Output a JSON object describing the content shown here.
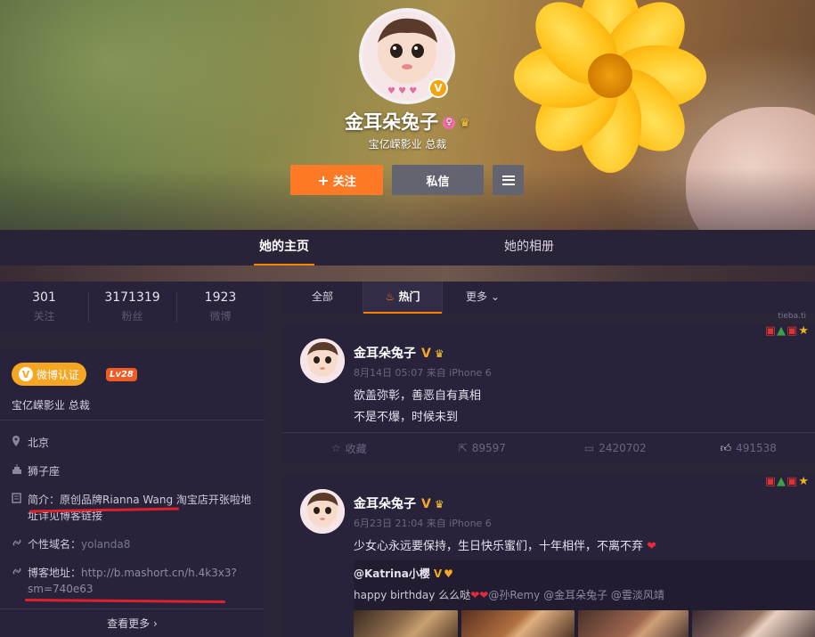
{
  "profile": {
    "name": "金耳朵兔子",
    "description": "宝亿嵘影业 总裁",
    "follow_label": "关注",
    "message_label": "私信",
    "verified_mark": "V",
    "female_icon": "♀",
    "crown_icon": "♛"
  },
  "nav": {
    "tabs": [
      {
        "label": "她的主页",
        "active": true
      },
      {
        "label": "她的相册",
        "active": false
      }
    ]
  },
  "stats": [
    {
      "value": "301",
      "label": "关注"
    },
    {
      "value": "3171319",
      "label": "粉丝"
    },
    {
      "value": "1923",
      "label": "微博"
    }
  ],
  "info": {
    "verify_label": "微博认证",
    "verify_mark": "V",
    "level": "Lv28",
    "title": "宝亿嵘影业 总裁",
    "location": "北京",
    "constellation": "狮子座",
    "intro_label": "简介：",
    "intro_text": "原创品牌Rianna Wang 淘宝店开张啦地址详见博客链接",
    "domain_label": "个性域名：",
    "domain_value": "yolanda8",
    "blog_label": "博客地址：",
    "blog_value": "http://b.mashort.cn/h.4k3x3?sm=740e63",
    "see_more": "查看更多"
  },
  "feed_tabs": {
    "all": "全部",
    "hot": "热门",
    "more": "更多"
  },
  "posts": [
    {
      "author": "金耳朵兔子",
      "vmark": "V",
      "meta": "8月14日 05:07 来自 iPhone 6",
      "lines": [
        "欲盖弥彰，善恶自有真相",
        "不是不爆，时候未到"
      ],
      "actions": {
        "favorite": "收藏",
        "forward": "89597",
        "comment": "2420702",
        "like": "491538"
      }
    },
    {
      "author": "金耳朵兔子",
      "vmark": "V",
      "meta": "6月23日 21:04 来自 iPhone 6",
      "text": "少女心永远要保持，生日快乐蜜们，十年相伴，不离不弃",
      "quote": {
        "author": "@Katrina小樱",
        "vmark": "V",
        "text_start": "happy birthday 么么哒",
        "mentions": "@孙Remy @金耳朵兔子 @雲淡风靖"
      }
    }
  ],
  "decoration_tag": "tieba.ti",
  "colors": {
    "accent": "#ff8200",
    "follow": "#ff7a26",
    "verify": "#f5a623",
    "level": "#f25a24",
    "background": "#2b2538"
  }
}
